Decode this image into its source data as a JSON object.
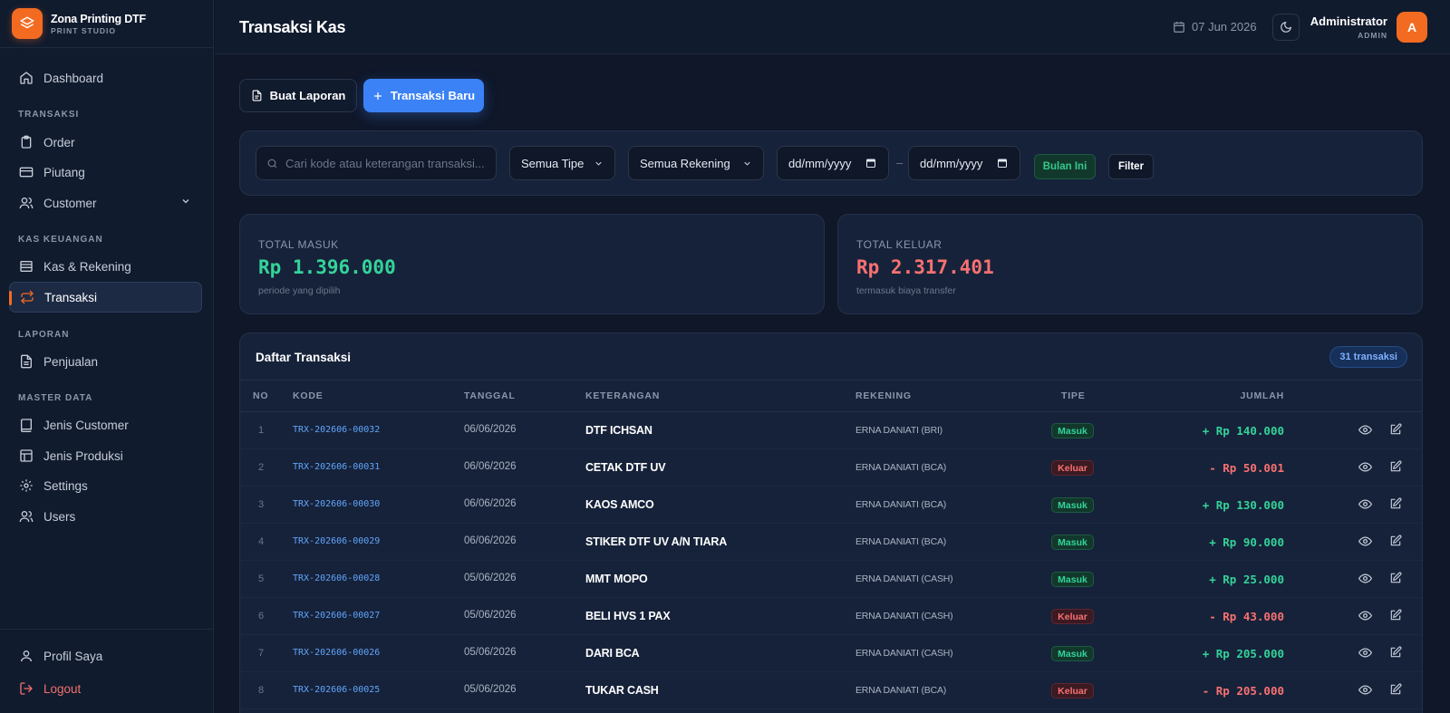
{
  "brand": {
    "name": "Zona Printing DTF",
    "subtitle": "PRINT STUDIO"
  },
  "sidebar": {
    "dashboard": "Dashboard",
    "section_transaksi": "TRANSAKSI",
    "order": "Order",
    "piutang": "Piutang",
    "customer": "Customer",
    "section_kas": "KAS KEUANGAN",
    "kas_rekening": "Kas & Rekening",
    "transaksi": "Transaksi",
    "section_laporan": "LAPORAN",
    "penjualan": "Penjualan",
    "section_master": "MASTER DATA",
    "jenis_customer": "Jenis Customer",
    "jenis_produksi": "Jenis Produksi",
    "settings": "Settings",
    "users": "Users",
    "profil": "Profil Saya",
    "logout": "Logout"
  },
  "header": {
    "title": "Transaksi Kas",
    "date": "07 Jun 2026",
    "user_name": "Administrator",
    "user_role": "ADMIN",
    "avatar_initial": "A"
  },
  "actions": {
    "report": "Buat Laporan",
    "new": "Transaksi Baru"
  },
  "filters": {
    "search_placeholder": "Cari kode atau keterangan transaksi...",
    "type": "Semua Tipe",
    "account": "Semua Rekening",
    "date_from": "dd/mm/yyyy",
    "date_sep": "–",
    "date_to": "dd/mm/yyyy",
    "this_month": "Bulan Ini",
    "filter": "Filter"
  },
  "stats": {
    "in_label": "TOTAL MASUK",
    "in_value": "Rp 1.396.000",
    "in_note": "periode yang dipilih",
    "out_label": "TOTAL KELUAR",
    "out_value": "Rp 2.317.401",
    "out_note": "termasuk biaya transfer"
  },
  "table": {
    "title": "Daftar Transaksi",
    "count": "31 transaksi",
    "columns": {
      "no": "NO",
      "code": "KODE",
      "date": "TANGGAL",
      "desc": "KETERANGAN",
      "account": "REKENING",
      "type": "TIPE",
      "amount": "JUMLAH"
    },
    "rows": [
      {
        "no": "1",
        "code": "TRX-202606-00032",
        "date": "06/06/2026",
        "desc": "DTF ICHSAN",
        "account": "ERNA DANIATI (BRI)",
        "type": "Masuk",
        "amount": "+ Rp 140.000"
      },
      {
        "no": "2",
        "code": "TRX-202606-00031",
        "date": "06/06/2026",
        "desc": "CETAK DTF UV",
        "account": "ERNA DANIATI (BCA)",
        "type": "Keluar",
        "amount": "- Rp 50.001"
      },
      {
        "no": "3",
        "code": "TRX-202606-00030",
        "date": "06/06/2026",
        "desc": "KAOS AMCO",
        "account": "ERNA DANIATI (BCA)",
        "type": "Masuk",
        "amount": "+ Rp 130.000"
      },
      {
        "no": "4",
        "code": "TRX-202606-00029",
        "date": "06/06/2026",
        "desc": "STIKER DTF UV A/N TIARA",
        "account": "ERNA DANIATI (BCA)",
        "type": "Masuk",
        "amount": "+ Rp 90.000"
      },
      {
        "no": "5",
        "code": "TRX-202606-00028",
        "date": "05/06/2026",
        "desc": "MMT MOPO",
        "account": "ERNA DANIATI (CASH)",
        "type": "Masuk",
        "amount": "+ Rp 25.000"
      },
      {
        "no": "6",
        "code": "TRX-202606-00027",
        "date": "05/06/2026",
        "desc": "BELI HVS 1 PAX",
        "account": "ERNA DANIATI (CASH)",
        "type": "Keluar",
        "amount": "- Rp 43.000"
      },
      {
        "no": "7",
        "code": "TRX-202606-00026",
        "date": "05/06/2026",
        "desc": "DARI BCA",
        "account": "ERNA DANIATI (CASH)",
        "type": "Masuk",
        "amount": "+ Rp 205.000"
      },
      {
        "no": "8",
        "code": "TRX-202606-00025",
        "date": "05/06/2026",
        "desc": "TUKAR CASH",
        "account": "ERNA DANIATI (BCA)",
        "type": "Keluar",
        "amount": "- Rp 205.000"
      }
    ]
  },
  "colors": {
    "accent": "#f26b21",
    "primary": "#3b82f6",
    "in": "#34d399",
    "out": "#f87171",
    "bg": "#0f1729",
    "card": "#16223a"
  }
}
